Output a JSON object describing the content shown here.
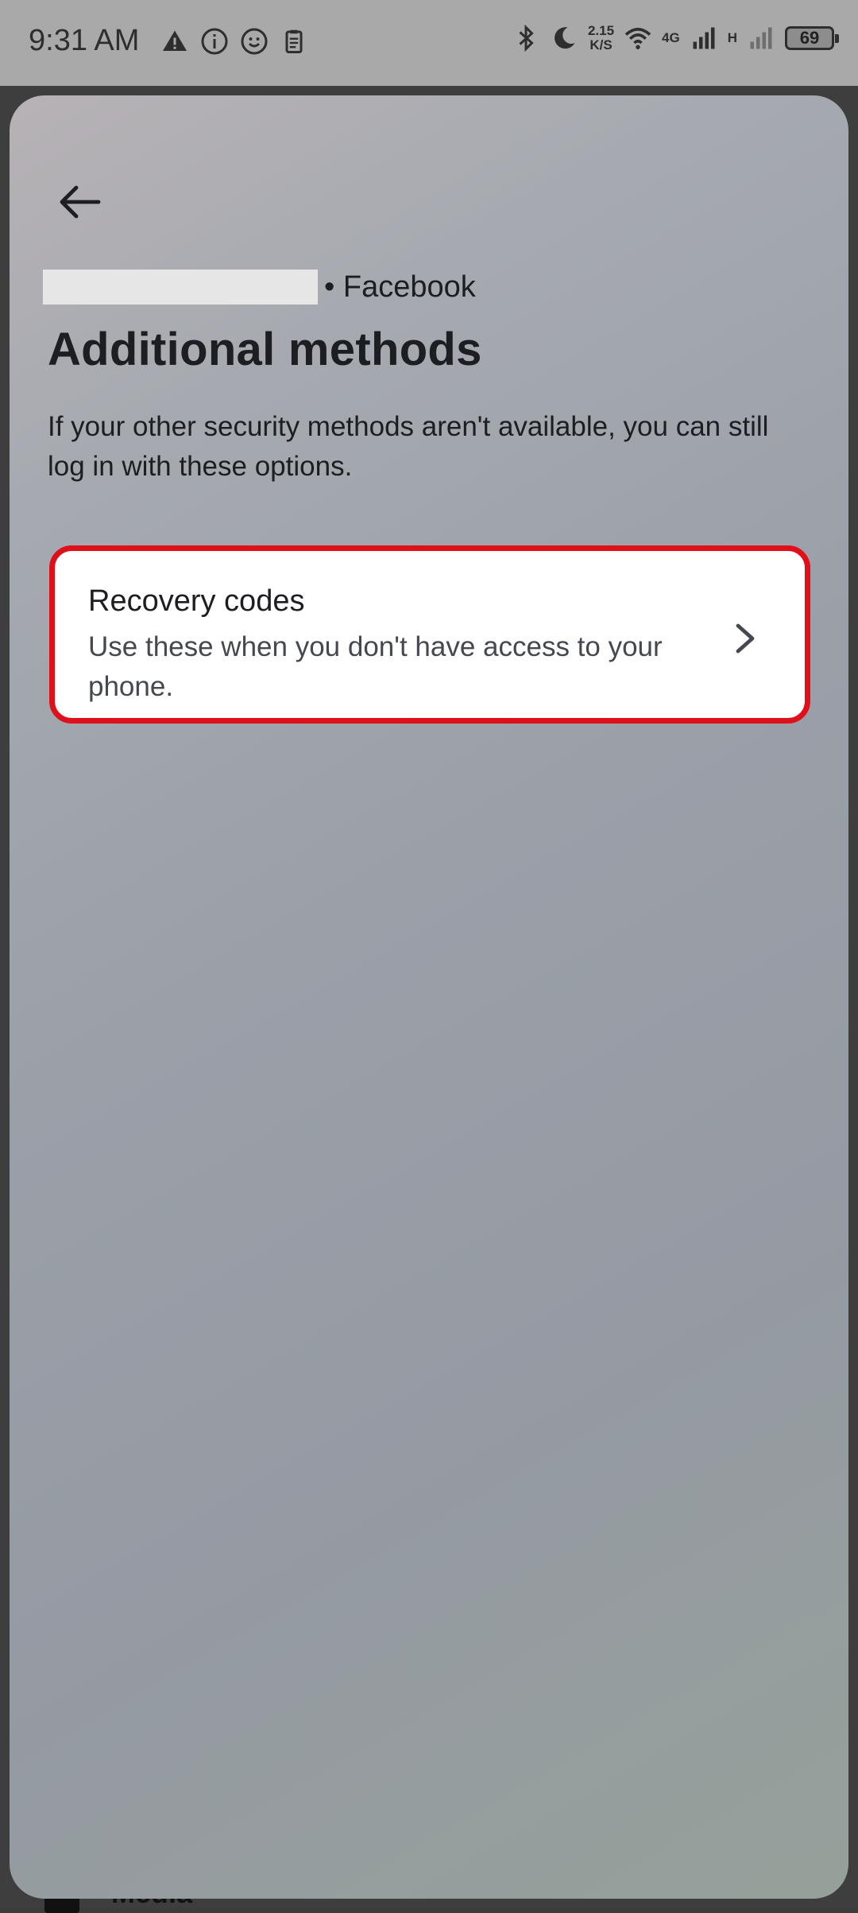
{
  "status_bar": {
    "time": "9:31 AM",
    "speed_value": "2.15",
    "speed_unit": "K/S",
    "net_label_1": "4G",
    "net_label_2": "H",
    "battery": "69"
  },
  "background_page": {
    "partial_label": "Media"
  },
  "sheet": {
    "account_suffix": "• Facebook",
    "title": "Additional methods",
    "description": "If your other security methods aren't available, you can still log in with these options.",
    "options": [
      {
        "title": "Recovery codes",
        "subtitle": "Use these when you don't have access to your phone."
      }
    ]
  },
  "colors": {
    "highlight_border": "#e0101b",
    "text_primary": "#1c1e21",
    "text_secondary": "#45494f"
  }
}
